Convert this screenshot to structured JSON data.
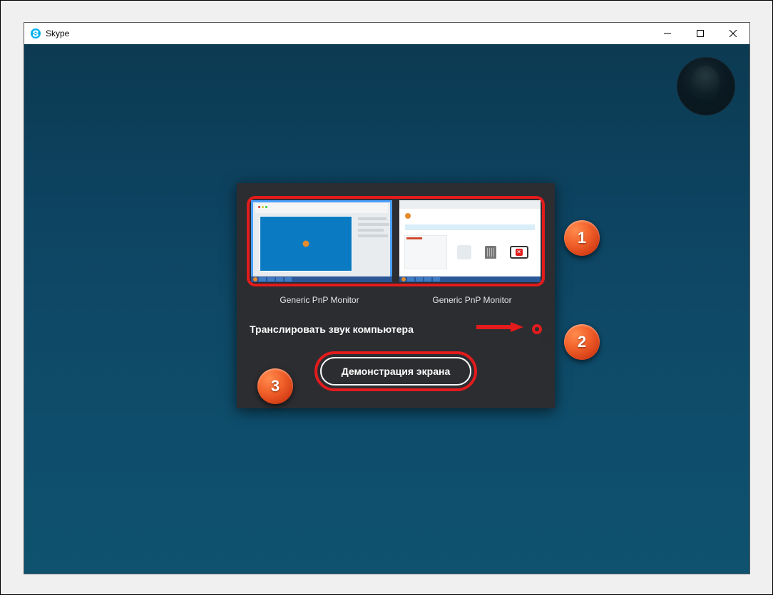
{
  "window": {
    "title": "Skype"
  },
  "panel": {
    "monitors": [
      {
        "label": "Generic PnP Monitor",
        "selected": true
      },
      {
        "label": "Generic PnP Monitor",
        "selected": false
      }
    ],
    "audio_label": "Транслировать звук компьютера",
    "toggle_on": false,
    "start_button": "Демонстрация экрана"
  },
  "callouts": {
    "one": "1",
    "two": "2",
    "three": "3"
  }
}
